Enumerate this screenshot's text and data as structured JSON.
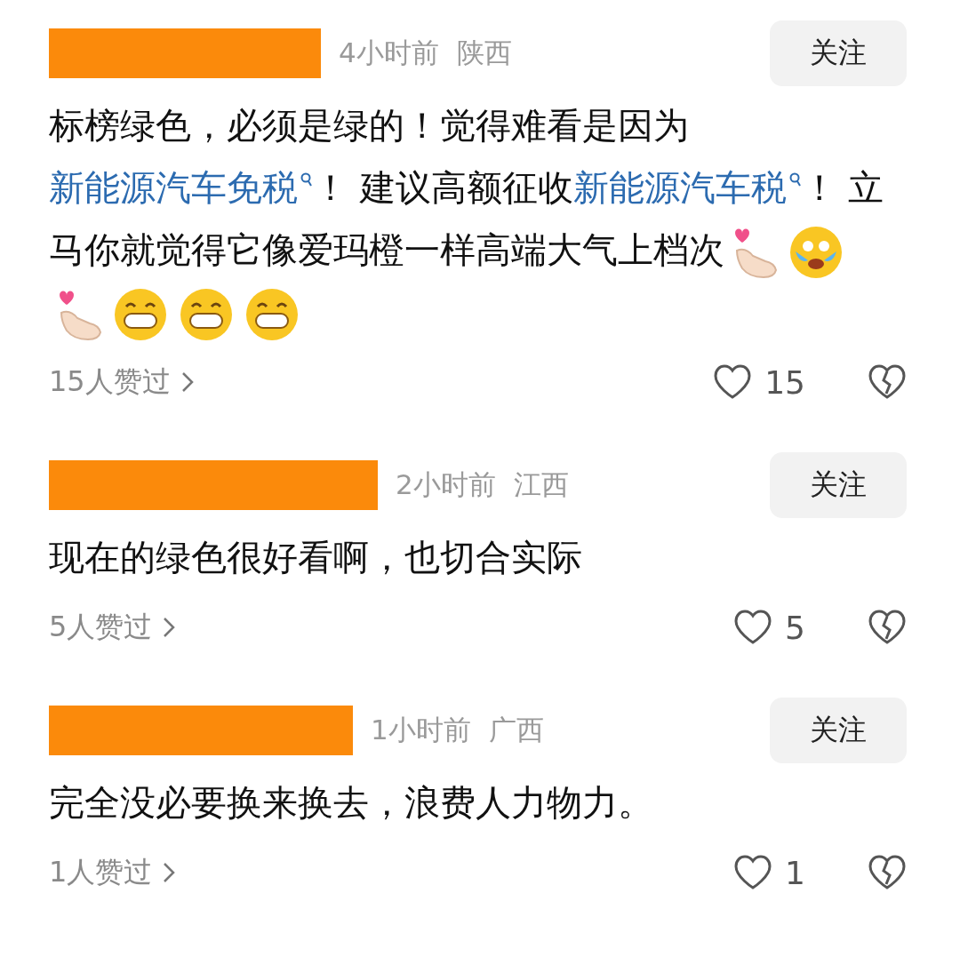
{
  "comments": [
    {
      "time": "4小时前",
      "region": "陕西",
      "follow": "关注",
      "body": [
        {
          "kind": "text",
          "text": "标榜绿色，必须是绿的！觉得难看是因为"
        },
        {
          "kind": "link",
          "text": "新能源汽车免税"
        },
        {
          "kind": "text",
          "text": "！ 建议高额征收"
        },
        {
          "kind": "link",
          "text": "新能源汽车税"
        },
        {
          "kind": "text",
          "text": "！ 立马你就觉得它像爱玛橙一样高端大气上档次"
        },
        {
          "kind": "finger-heart"
        },
        {
          "kind": "teary-laugh"
        },
        {
          "kind": "finger-heart"
        },
        {
          "kind": "grin"
        },
        {
          "kind": "grin"
        },
        {
          "kind": "grin"
        }
      ],
      "likers": "15人赞过",
      "likes": "15"
    },
    {
      "time": "2小时前",
      "region": "江西",
      "follow": "关注",
      "body": [
        {
          "kind": "text",
          "text": "现在的绿色很好看啊，也切合实际"
        }
      ],
      "likers": "5人赞过",
      "likes": "5"
    },
    {
      "time": "1小时前",
      "region": "广西",
      "follow": "关注",
      "body": [
        {
          "kind": "text",
          "text": "完全没必要换来换去，浪费人力物力。"
        }
      ],
      "likers": "1人赞过",
      "likes": "1"
    }
  ]
}
